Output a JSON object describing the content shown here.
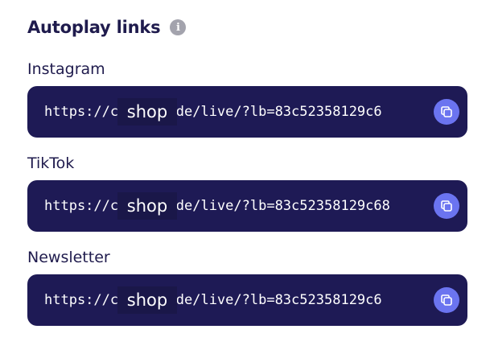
{
  "section": {
    "title": "Autoplay links",
    "info_icon": "info-icon"
  },
  "links": [
    {
      "label": "Instagram",
      "url": "https://c shops.de/live/?lb=83c52358129c6",
      "masked_text": "shop"
    },
    {
      "label": "TikTok",
      "url": "https://c shops.de/live/?lb=83c52358129c68",
      "masked_text": "shop"
    },
    {
      "label": "Newsletter",
      "url": "https://c shops.de/live/?lb=83c52358129c6",
      "masked_text": "shop"
    }
  ],
  "icons": {
    "copy": "copy-icon",
    "info": "info-icon"
  },
  "colors": {
    "box_background": "#1e1a55",
    "copy_button": "#6b74f0",
    "title_text": "#1f1b4d",
    "info_icon": "#a3a3ad"
  }
}
